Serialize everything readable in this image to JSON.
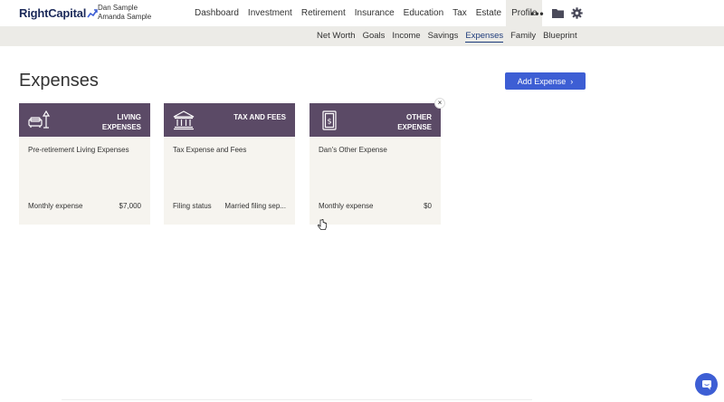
{
  "brand": {
    "logo_text": "RightCapital"
  },
  "users": {
    "primary": "Dan Sample",
    "secondary": "Amanda Sample"
  },
  "main_nav": [
    {
      "label": "Dashboard"
    },
    {
      "label": "Investment"
    },
    {
      "label": "Retirement"
    },
    {
      "label": "Insurance"
    },
    {
      "label": "Education"
    },
    {
      "label": "Tax"
    },
    {
      "label": "Estate"
    },
    {
      "label": "Profile",
      "active": true
    }
  ],
  "top_icons": {
    "more": "•••",
    "folder": "folder-icon",
    "settings": "gear-icon"
  },
  "sub_nav": [
    {
      "label": "Net Worth"
    },
    {
      "label": "Goals"
    },
    {
      "label": "Income"
    },
    {
      "label": "Savings"
    },
    {
      "label": "Expenses",
      "active": true
    },
    {
      "label": "Family"
    },
    {
      "label": "Blueprint"
    }
  ],
  "page": {
    "title": "Expenses",
    "add_button": "Add Expense",
    "add_button_chevron": "›"
  },
  "cards": [
    {
      "title": "LIVING\nEXPENSES",
      "icon": "living-room-icon",
      "description": "Pre-retirement Living Expenses",
      "foot_label": "Monthly expense",
      "foot_value": "$7,000"
    },
    {
      "title": "TAX AND FEES",
      "icon": "bank-icon",
      "description": "Tax Expense and Fees",
      "foot_label": "Filing status",
      "foot_value": "Married filing sep..."
    },
    {
      "title": "OTHER\nEXPENSE",
      "icon": "bill-icon",
      "description": "Dan's Other Expense",
      "foot_label": "Monthly expense",
      "foot_value": "$0"
    }
  ],
  "close_glyph": "×",
  "colors": {
    "accent": "#3d5ed4",
    "card_header": "#5b4a66",
    "card_bg": "#f6f4ef",
    "subbar_bg": "#ecebe7"
  }
}
